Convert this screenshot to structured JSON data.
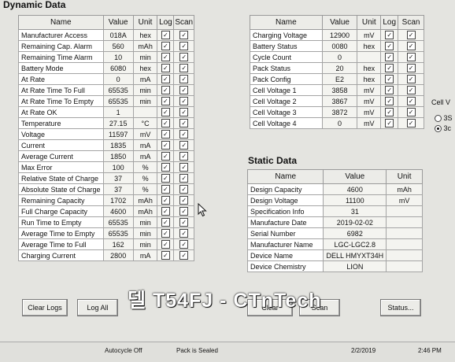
{
  "dynamic": {
    "title": "Dynamic Data",
    "headers": [
      "Name",
      "Value",
      "Unit",
      "Log",
      "Scan"
    ],
    "rows": [
      {
        "name": "Manufacturer Access",
        "value": "018A",
        "unit": "hex",
        "log": true,
        "scan": true
      },
      {
        "name": "Remaining Cap. Alarm",
        "value": "560",
        "unit": "mAh",
        "log": true,
        "scan": true
      },
      {
        "name": "Remaining Time Alarm",
        "value": "10",
        "unit": "min",
        "log": true,
        "scan": true
      },
      {
        "name": "Battery Mode",
        "value": "6080",
        "unit": "hex",
        "log": true,
        "scan": true
      },
      {
        "name": "At Rate",
        "value": "0",
        "unit": "mA",
        "log": true,
        "scan": true
      },
      {
        "name": "At Rate Time To Full",
        "value": "65535",
        "unit": "min",
        "log": true,
        "scan": true
      },
      {
        "name": "At Rate Time To Empty",
        "value": "65535",
        "unit": "min",
        "log": true,
        "scan": true
      },
      {
        "name": "At Rate OK",
        "value": "1",
        "unit": "",
        "log": true,
        "scan": true
      },
      {
        "name": "Temperature",
        "value": "27.15",
        "unit": "°C",
        "log": true,
        "scan": true
      },
      {
        "name": "Voltage",
        "value": "11597",
        "unit": "mV",
        "log": true,
        "scan": true
      },
      {
        "name": "Current",
        "value": "1835",
        "unit": "mA",
        "log": true,
        "scan": true
      },
      {
        "name": "Average Current",
        "value": "1850",
        "unit": "mA",
        "log": true,
        "scan": true
      },
      {
        "name": "Max Error",
        "value": "100",
        "unit": "%",
        "log": true,
        "scan": true
      },
      {
        "name": "Relative State of Charge",
        "value": "37",
        "unit": "%",
        "log": true,
        "scan": true
      },
      {
        "name": "Absolute State of Charge",
        "value": "37",
        "unit": "%",
        "log": true,
        "scan": true
      },
      {
        "name": "Remaining Capacity",
        "value": "1702",
        "unit": "mAh",
        "log": true,
        "scan": true
      },
      {
        "name": "Full Charge Capacity",
        "value": "4600",
        "unit": "mAh",
        "log": true,
        "scan": true
      },
      {
        "name": "Run Time to Empty",
        "value": "65535",
        "unit": "min",
        "log": true,
        "scan": true
      },
      {
        "name": "Average Time to Empty",
        "value": "65535",
        "unit": "min",
        "log": true,
        "scan": true
      },
      {
        "name": "Average Time to Full",
        "value": "162",
        "unit": "min",
        "log": true,
        "scan": true
      },
      {
        "name": "Charging Current",
        "value": "2800",
        "unit": "mA",
        "log": true,
        "scan": true
      }
    ]
  },
  "dynamic2": {
    "headers": [
      "Name",
      "Value",
      "Unit",
      "Log",
      "Scan"
    ],
    "rows": [
      {
        "name": "Charging Voltage",
        "value": "12900",
        "unit": "mV",
        "log": true,
        "scan": true
      },
      {
        "name": "Battery Status",
        "value": "0080",
        "unit": "hex",
        "log": true,
        "scan": true
      },
      {
        "name": "Cycle Count",
        "value": "0",
        "unit": "",
        "log": true,
        "scan": true
      },
      {
        "name": "Pack Status",
        "value": "20",
        "unit": "hex",
        "log": true,
        "scan": true
      },
      {
        "name": "Pack Config",
        "value": "E2",
        "unit": "hex",
        "log": true,
        "scan": true
      },
      {
        "name": "Cell Voltage 1",
        "value": "3858",
        "unit": "mV",
        "log": true,
        "scan": true
      },
      {
        "name": "Cell Voltage 2",
        "value": "3867",
        "unit": "mV",
        "log": true,
        "scan": true
      },
      {
        "name": "Cell Voltage 3",
        "value": "3872",
        "unit": "mV",
        "log": true,
        "scan": true
      },
      {
        "name": "Cell Voltage 4",
        "value": "0",
        "unit": "mV",
        "log": true,
        "scan": true
      }
    ]
  },
  "side": {
    "label": "Cell V",
    "options": [
      {
        "label": "3S",
        "selected": false
      },
      {
        "label": "3c",
        "selected": true
      }
    ]
  },
  "static": {
    "title": "Static Data",
    "headers": [
      "Name",
      "Value",
      "Unit"
    ],
    "rows": [
      {
        "name": "Design Capacity",
        "value": "4600",
        "unit": "mAh"
      },
      {
        "name": "Design Voltage",
        "value": "11100",
        "unit": "mV"
      },
      {
        "name": "Specification Info",
        "value": "31",
        "unit": ""
      },
      {
        "name": "Manufacture Date",
        "value": "2019-02-02",
        "unit": ""
      },
      {
        "name": "Serial Number",
        "value": "6982",
        "unit": ""
      },
      {
        "name": "Manufacturer Name",
        "value": "LGC-LGC2.8",
        "unit": ""
      },
      {
        "name": "Device Name",
        "value": "DELL HMYXT34H",
        "unit": ""
      },
      {
        "name": "Device Chemistry",
        "value": "LION",
        "unit": ""
      }
    ]
  },
  "buttons": {
    "clear_logs": "Clear Logs",
    "log_all": "Log All",
    "clear_scans": "Clear",
    "scan_all": "Scan",
    "status": "Status..."
  },
  "statusbar": {
    "autocycle": "Autocycle Off",
    "pack": "Pack is Sealed",
    "date": "2/2/2019",
    "time": "2:46 PM"
  },
  "watermark": "델 T54FJ  -  CTnTech"
}
